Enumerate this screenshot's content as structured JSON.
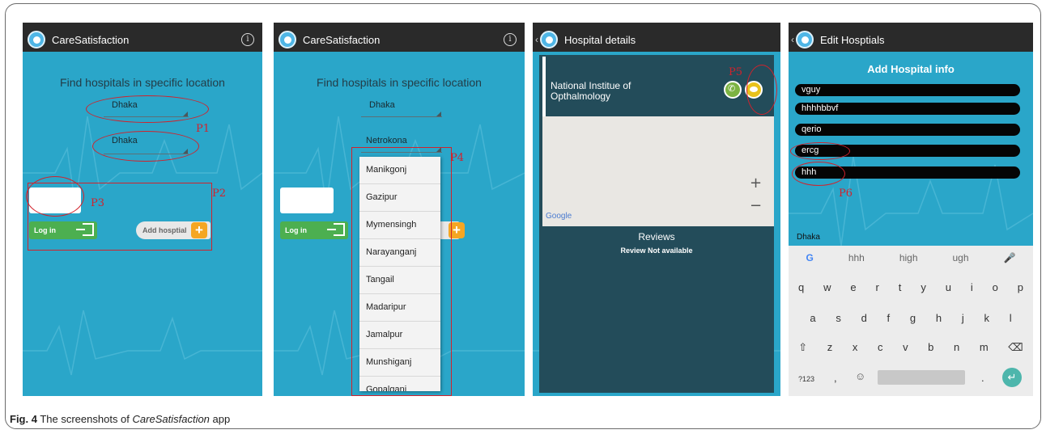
{
  "figure": {
    "caption_label": "Fig. 4",
    "caption_text_prefix": "The screenshots of",
    "caption_app_name": "CareSatisfaction",
    "caption_text_suffix": "app"
  },
  "colors": {
    "accent": "#2aa6c9",
    "appbar": "#2a2a2a",
    "annotation_red": "#d1222c",
    "login_green": "#4caf50",
    "add_orange": "#f5a623"
  },
  "screen1": {
    "title": "CareSatisfaction",
    "info_icon": "info-icon",
    "heading": "Find hospitals in specific location",
    "spinner1_value": "Dhaka",
    "spinner2_value": "Dhaka",
    "login_label": "Log in",
    "add_label": "Add hosptial",
    "annotations": {
      "p1": "P1",
      "p2": "P2",
      "p3": "P3"
    }
  },
  "screen2": {
    "title": "CareSatisfaction",
    "heading": "Find hospitals in specific location",
    "spinner1_value": "Dhaka",
    "spinner2_value": "Netrokona",
    "login_label": "Log in",
    "dropdown_options": [
      "Manikgonj",
      "Gazipur",
      "Mymensingh",
      "Narayanganj",
      "Tangail",
      "Madaripur",
      "Jamalpur",
      "Munshiganj",
      "Gopalganj"
    ],
    "annotations": {
      "p4": "P4"
    }
  },
  "screen3": {
    "title": "Hospital details",
    "hospital_name": "National Institue of Opthalmology",
    "map_brand": "Google",
    "zoom_in": "+",
    "zoom_out": "−",
    "reviews_title": "Reviews",
    "reviews_status": "Review Not available",
    "annotations": {
      "p5": "P5"
    }
  },
  "screen4": {
    "title": "Edit Hosptials",
    "form_title": "Add Hospital info",
    "fields": [
      "vguy",
      "hhhhbbvf",
      "qerio",
      "ercg",
      "hhh"
    ],
    "location_label": "Dhaka",
    "suggestions": [
      "hhh",
      "high",
      "ugh"
    ],
    "keyboard_rows": [
      [
        "q",
        "w",
        "e",
        "r",
        "t",
        "y",
        "u",
        "i",
        "o",
        "p"
      ],
      [
        "a",
        "s",
        "d",
        "f",
        "g",
        "h",
        "j",
        "k",
        "l"
      ],
      [
        "⇧",
        "z",
        "x",
        "c",
        "v",
        "b",
        "n",
        "m",
        "⌫"
      ]
    ],
    "bottom_row": {
      "symbols": "?123",
      "comma": ",",
      "emoji": "☺",
      "period": "."
    },
    "annotations": {
      "p6": "P6"
    }
  }
}
